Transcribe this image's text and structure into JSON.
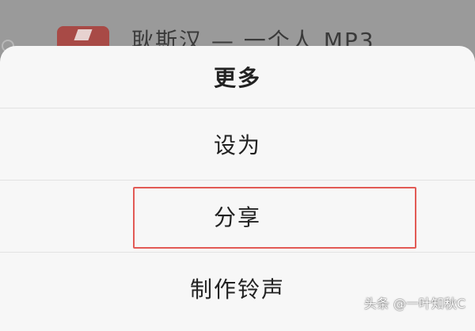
{
  "background": {
    "list_item_title": "耿斯汉 — 一个人 MP3"
  },
  "sheet": {
    "title": "更多",
    "items": [
      {
        "label": "设为"
      },
      {
        "label": "分享"
      },
      {
        "label": "制作铃声"
      }
    ],
    "highlighted_item": "分享"
  },
  "watermark": "头条 @一叶知秋C",
  "colors": {
    "overlay": "#8f8f8f",
    "sheet_bg": "#f7f7f7",
    "app_icon": "#a84a46",
    "highlight_border": "#e25a55",
    "text": "#222222"
  }
}
